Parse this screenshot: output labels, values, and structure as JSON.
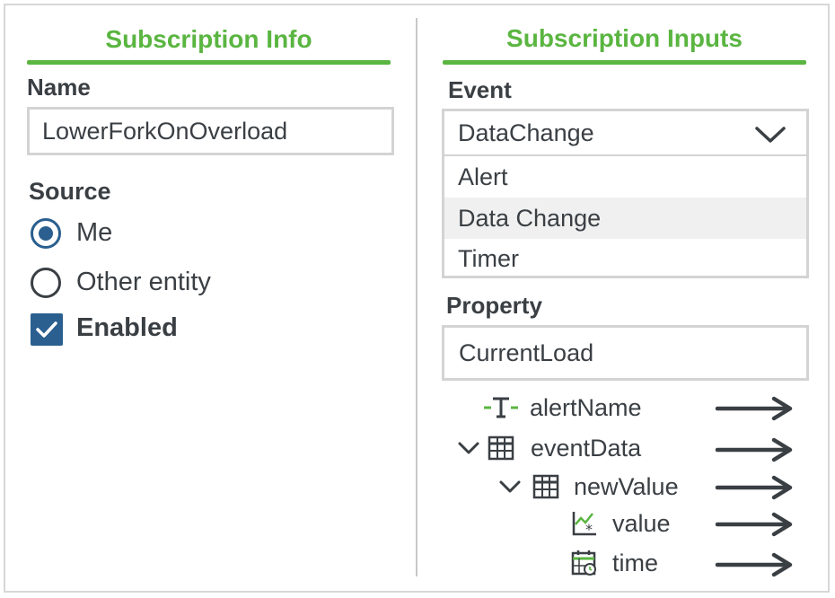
{
  "left_panel": {
    "title": "Subscription Info",
    "name_label": "Name",
    "name_value": "LowerForkOnOverload",
    "source_label": "Source",
    "source_options": [
      {
        "label": "Me",
        "selected": true
      },
      {
        "label": "Other entity",
        "selected": false
      }
    ],
    "enabled_label": "Enabled",
    "enabled_checked": true
  },
  "right_panel": {
    "title": "Subscription Inputs",
    "event_label": "Event",
    "event_selected": "DataChange",
    "event_options": [
      "Alert",
      "Data Change",
      "Timer"
    ],
    "event_highlighted": "Data Change",
    "property_label": "Property",
    "property_value": "CurrentLoad",
    "tree": [
      {
        "label": "alertName",
        "icon": "text-type-icon",
        "expandable": false
      },
      {
        "label": "eventData",
        "icon": "table-icon",
        "expandable": true,
        "expanded": true
      },
      {
        "label": "newValue",
        "icon": "table-icon",
        "expandable": true,
        "expanded": true
      },
      {
        "label": "value",
        "icon": "number-chart-icon",
        "expandable": false
      },
      {
        "label": "time",
        "icon": "datetime-icon",
        "expandable": false
      }
    ]
  },
  "colors": {
    "accent_green": "#5ab541",
    "selection_blue": "#2a5f8f",
    "text": "#3a3f44",
    "border": "#d3d3d3"
  }
}
